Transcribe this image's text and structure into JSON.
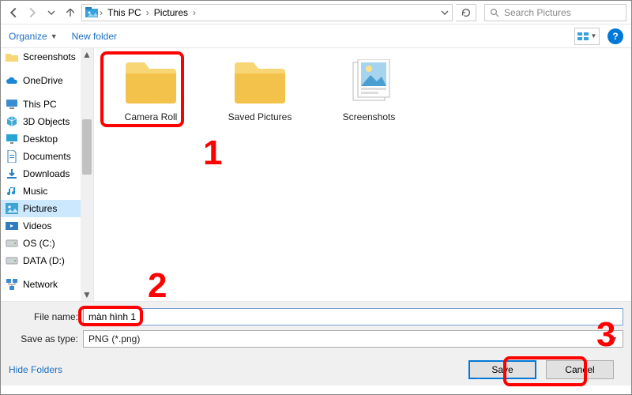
{
  "addressbar": {
    "segments": [
      "This PC",
      "Pictures"
    ],
    "search_placeholder": "Search Pictures",
    "refresh_icon": "refresh-icon"
  },
  "toolbar": {
    "organize_label": "Organize",
    "newfolder_label": "New folder"
  },
  "sidebar": {
    "items": [
      {
        "label": "Screenshots",
        "icon": "folder",
        "color": "#f8d676"
      },
      {
        "label": "OneDrive",
        "icon": "cloud",
        "color": "#1c87d4"
      },
      {
        "label": "This PC",
        "icon": "pc",
        "color": "#3b8bd0"
      },
      {
        "label": "3D Objects",
        "icon": "cube",
        "color": "#3da9d6"
      },
      {
        "label": "Desktop",
        "icon": "desktop",
        "color": "#29a3d6"
      },
      {
        "label": "Documents",
        "icon": "doc",
        "color": "#2f7dc0"
      },
      {
        "label": "Downloads",
        "icon": "download",
        "color": "#2f7dc0"
      },
      {
        "label": "Music",
        "icon": "music",
        "color": "#1f8fd0"
      },
      {
        "label": "Pictures",
        "icon": "pictures",
        "color": "#3fa4d6",
        "selected": true
      },
      {
        "label": "Videos",
        "icon": "video",
        "color": "#2f7dc0"
      },
      {
        "label": "OS (C:)",
        "icon": "disk",
        "color": "#9aa0a6"
      },
      {
        "label": "DATA (D:)",
        "icon": "disk",
        "color": "#9aa0a6"
      },
      {
        "label": "Network",
        "icon": "network",
        "color": "#3b8bd0"
      }
    ]
  },
  "content": {
    "folders": [
      {
        "label": "Camera Roll",
        "type": "folder"
      },
      {
        "label": "Saved Pictures",
        "type": "folder"
      },
      {
        "label": "Screenshots",
        "type": "thumbs"
      }
    ]
  },
  "bottom": {
    "filename_label": "File name:",
    "filename_value": "màn hình 1",
    "filetype_label": "Save as type:",
    "filetype_value": "PNG (*.png)"
  },
  "footer": {
    "hide_folders_label": "Hide Folders",
    "save_label": "Save",
    "cancel_label": "Cancel"
  },
  "annotations": {
    "n1": "1",
    "n2": "2",
    "n3": "3"
  }
}
